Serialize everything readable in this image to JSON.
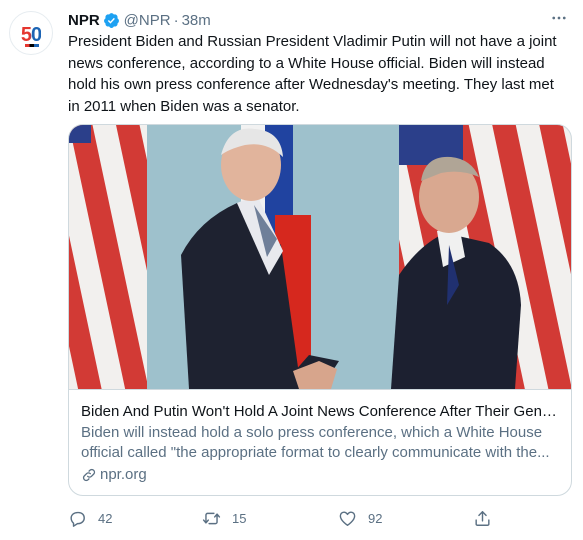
{
  "tweet": {
    "author_name": "NPR",
    "handle": "@NPR",
    "separator": "·",
    "time": "38m",
    "text": "President Biden and Russian President Vladimir Putin will not have a joint news conference, according to a White House official. Biden will instead hold his own press conference after Wednesday's meeting. They last met in 2011 when Biden was a senator.",
    "avatar": {
      "text": "50",
      "icon": "npr-50-logo"
    }
  },
  "card": {
    "title": "Biden And Putin Won't Hold A Joint News Conference After Their Gene...",
    "description": "Biden will instead hold a solo press conference, which a White House official called \"the appropriate format to clearly communicate with the...",
    "domain": "npr.org"
  },
  "actions": {
    "reply_count": "42",
    "retweet_count": "15",
    "like_count": "92"
  },
  "colors": {
    "verified_blue": "#1da1f2",
    "secondary_text": "#5b7083",
    "border": "#cfd9de"
  }
}
